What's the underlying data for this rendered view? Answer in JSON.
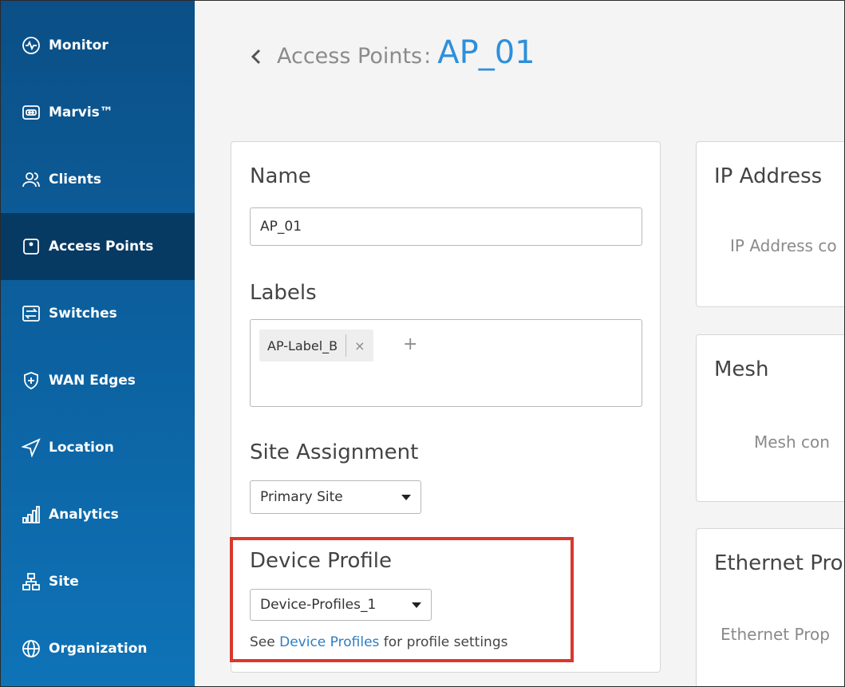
{
  "sidebar": {
    "items": [
      {
        "label": "Monitor",
        "icon": "monitor-icon"
      },
      {
        "label": "Marvis™",
        "icon": "marvis-icon"
      },
      {
        "label": "Clients",
        "icon": "clients-icon"
      },
      {
        "label": "Access Points",
        "icon": "access-point-icon",
        "active": true
      },
      {
        "label": "Switches",
        "icon": "switch-icon"
      },
      {
        "label": "WAN Edges",
        "icon": "wan-edge-shield-icon"
      },
      {
        "label": "Location",
        "icon": "location-arrow-icon"
      },
      {
        "label": "Analytics",
        "icon": "analytics-bars-icon"
      },
      {
        "label": "Site",
        "icon": "site-tree-icon"
      },
      {
        "label": "Organization",
        "icon": "globe-icon"
      }
    ]
  },
  "header": {
    "breadcrumb": "Access Points",
    "separator": ":",
    "title": "AP_01"
  },
  "details": {
    "name_label": "Name",
    "name_value": "AP_01",
    "labels_label": "Labels",
    "tags": [
      "AP-Label_B"
    ],
    "tag_remove": "×",
    "tag_add": "+",
    "site_label": "Site Assignment",
    "site_value": "Primary Site",
    "profile_label": "Device Profile",
    "profile_value": "Device-Profiles_1",
    "profile_help_prefix": "See ",
    "profile_help_link": "Device Profiles",
    "profile_help_suffix": " for profile settings"
  },
  "right_cards": {
    "ip_title": "IP Address",
    "ip_text": "IP Address co",
    "mesh_title": "Mesh",
    "mesh_text": "Mesh con",
    "ethernet_title": "Ethernet Pro",
    "ethernet_text": "Ethernet Prop"
  },
  "colors": {
    "sidebar_top": "#0b4f86",
    "sidebar_active": "#073a63",
    "title_blue": "#2e8fda",
    "link_blue": "#2e7dc1",
    "highlight_red": "#d9382c"
  }
}
